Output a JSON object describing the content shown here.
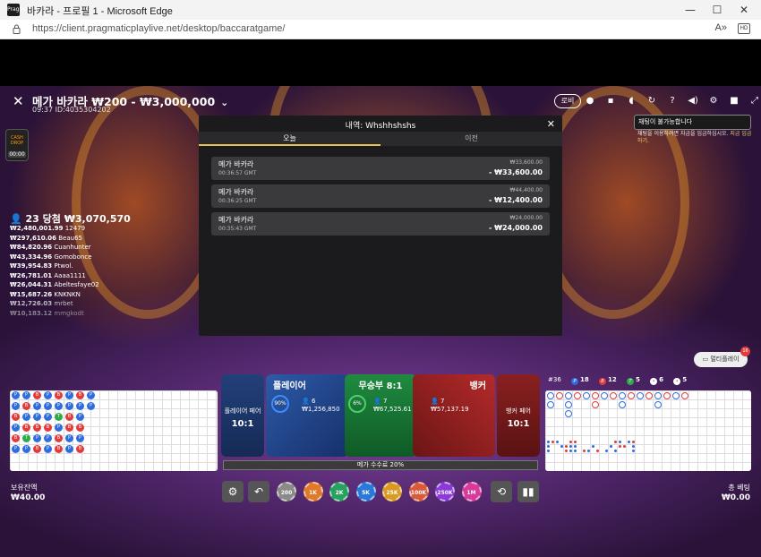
{
  "window": {
    "title": "바카라 - 프로필 1 - Microsoft Edge",
    "minimize": "—",
    "maximize": "☐",
    "close": "✕",
    "app_icon": "Pragmatic"
  },
  "address": {
    "url": "https://client.pragmaticplaylive.net/desktop/baccaratgame/",
    "read_aloud": "A»",
    "hd": "HD"
  },
  "header": {
    "close": "✕",
    "title": "메가 바카라 ₩200 - ₩3,000,000",
    "chevron": "⌄",
    "subtitle": "09:37 ID:4035304202",
    "lobby": "로비"
  },
  "header_icons": [
    "bulb-icon",
    "chat-icon",
    "headset-icon",
    "history-icon",
    "help-icon",
    "volume-icon",
    "settings-icon",
    "video-icon",
    "fullscreen-icon"
  ],
  "header_icon_glyphs": [
    "●",
    "▪",
    "◖",
    "↻",
    "?",
    "◀)",
    "⚙",
    "■",
    "⤢"
  ],
  "tooltip": {
    "text": "채팅이 불가능합니다",
    "sub": "채팅을 이용하려면 자금을 입금하십시오. ",
    "sub_link": "지금 입금하기."
  },
  "timer_badge": {
    "logo": "CASH DROP",
    "time": "00:00"
  },
  "winners": {
    "title": "23 당첨 ₩3,070,570",
    "rows": [
      {
        "amount": "₩2,480,001.99",
        "name": "12479"
      },
      {
        "amount": "₩297,610.06",
        "name": "Beau65"
      },
      {
        "amount": "₩84,820.96",
        "name": "Cuanhunter"
      },
      {
        "amount": "₩43,334.96",
        "name": "Gomobonce"
      },
      {
        "amount": "₩39,954.83",
        "name": "Ptwol."
      },
      {
        "amount": "₩26,781.01",
        "name": "Aaaa1111"
      },
      {
        "amount": "₩26,044.31",
        "name": "Abeltesfaye02"
      },
      {
        "amount": "₩15,687.26",
        "name": "KNKNKN"
      },
      {
        "amount": "₩12,726.03",
        "name": "mrbet"
      },
      {
        "amount": "₩10,183.12",
        "name": "mmgkodt"
      }
    ]
  },
  "modal": {
    "title": "내역: Whshhshshs",
    "close": "✕",
    "tabs": [
      "오늘",
      "이전"
    ],
    "rows": [
      {
        "name": "메가 바카라",
        "time": "00:36:57 GMT",
        "bet": "₩33,600.00",
        "result": "- ₩33,600.00"
      },
      {
        "name": "메가 바카라",
        "time": "00:36:25 GMT",
        "bet": "₩44,400.00",
        "result": "- ₩12,400.00"
      },
      {
        "name": "메가 바카라",
        "time": "00:35:43 GMT",
        "bet": "₩24,000.00",
        "result": "- ₩24,000.00"
      }
    ]
  },
  "multiplay": {
    "label": "멀티플레이",
    "badge": "16"
  },
  "stats": {
    "round": "#36",
    "player": "18",
    "banker": "12",
    "tie": "5",
    "p_pair": "6",
    "b_pair": "5"
  },
  "bets": {
    "player_pair": {
      "label": "플레이어 페어",
      "odds": "10:1"
    },
    "player": {
      "label": "플레이어",
      "percent": "90%",
      "bettors": "6",
      "amount": "₩1,256,850"
    },
    "tie": {
      "label": "무승부 8:1",
      "percent": "6%",
      "bettors": "7",
      "amount": "₩67,525.61"
    },
    "banker": {
      "label": "뱅커",
      "bettors": "7",
      "amount": "₩57,137.19"
    },
    "banker_pair": {
      "label": "뱅커 페어",
      "odds": "10:1"
    },
    "bonus": "메가 수수료 20%"
  },
  "balance": {
    "label": "보유잔액",
    "value": "₩40.00"
  },
  "total_bet": {
    "label": "총 베팅",
    "value": "₩0.00"
  },
  "controls": {
    "settings": "⚙",
    "undo": "↶",
    "repeat": "⟲",
    "stats": "▮▮"
  },
  "chips": [
    {
      "label": "200",
      "color": "#8a8a8a"
    },
    {
      "label": "1K",
      "color": "#e07a2a"
    },
    {
      "label": "2K",
      "color": "#2aa060"
    },
    {
      "label": "5K",
      "color": "#2a78d8"
    },
    {
      "label": "25K",
      "color": "#d89a20"
    },
    {
      "label": "100K",
      "color": "#d85a3a"
    },
    {
      "label": "250K",
      "color": "#8a3ad8"
    },
    {
      "label": "1M",
      "color": "#d83a9a"
    }
  ],
  "bead_road": [
    "P",
    "P",
    "B",
    "P",
    "B",
    "P",
    "P",
    "B",
    "P",
    "B",
    "T",
    "P",
    "B",
    "P",
    "P",
    "B",
    "P",
    "B",
    "P",
    "P",
    "P",
    "B",
    "P",
    "P",
    "B",
    "P",
    "T",
    "P",
    "B",
    "B",
    "P",
    "P",
    "B",
    "B",
    "P",
    "P",
    "B",
    "P",
    "P",
    "B",
    "P",
    "B",
    "P",
    "P"
  ]
}
